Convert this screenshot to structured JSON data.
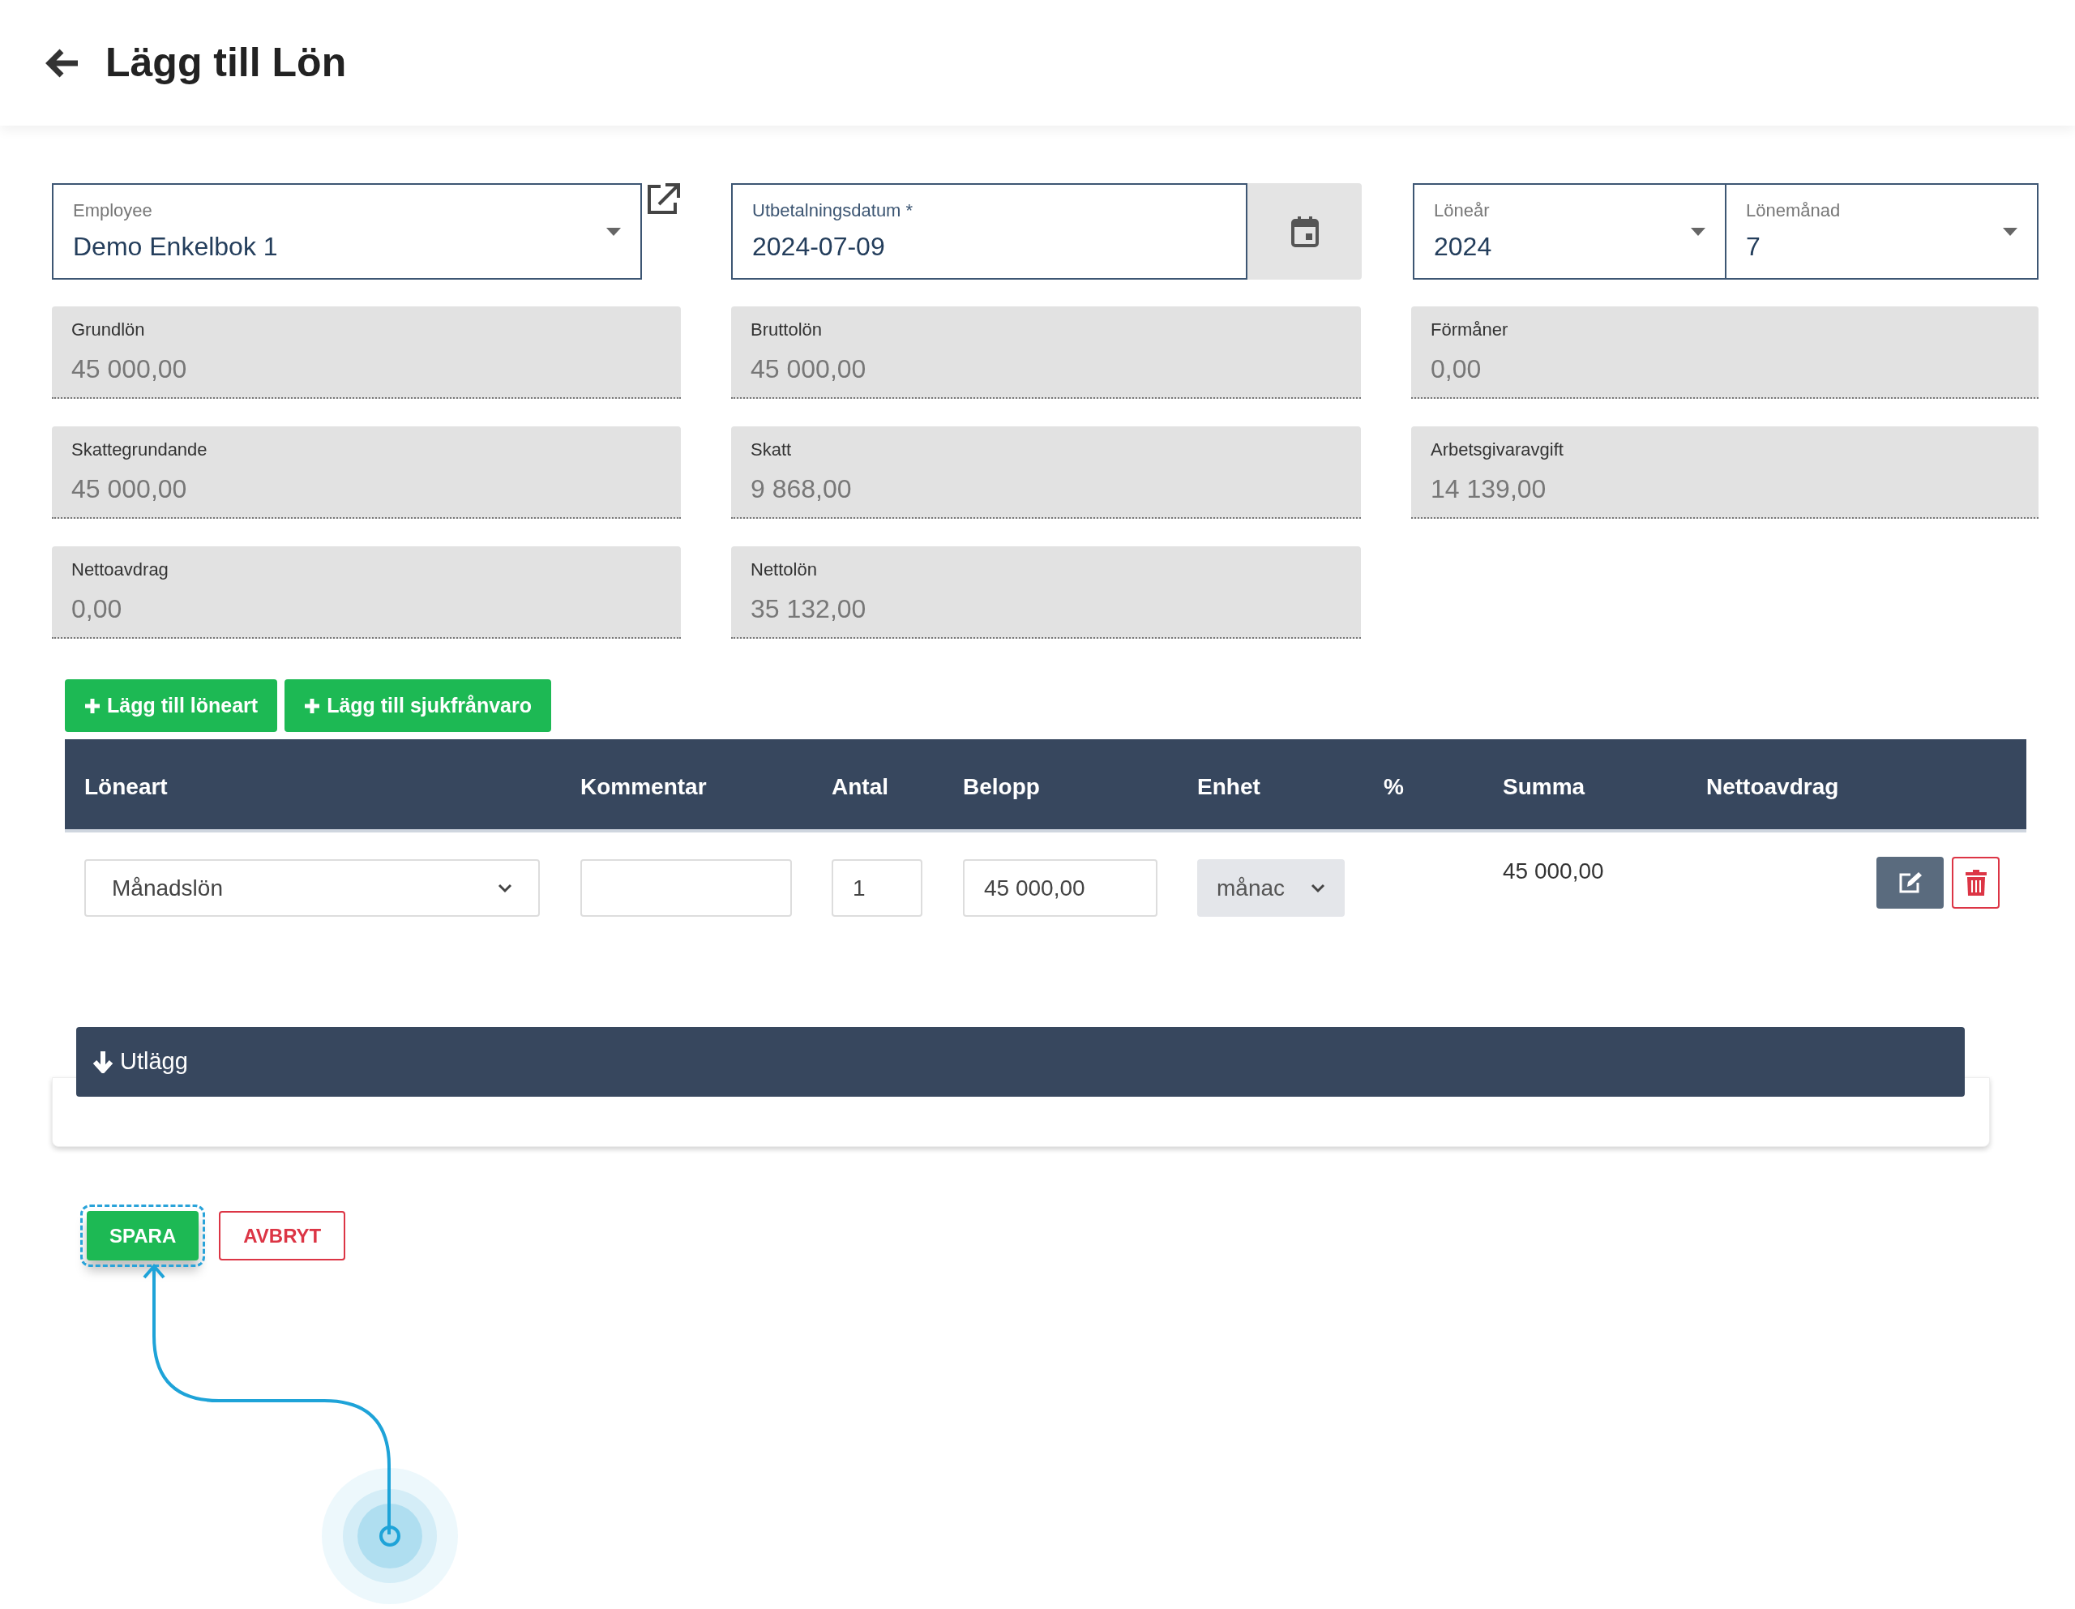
{
  "header": {
    "title": "Lägg till Lön"
  },
  "employee": {
    "label": "Employee",
    "value": "Demo Enkelbok 1"
  },
  "payment_date": {
    "label": "Utbetalningsdatum *",
    "value": "2024-07-09"
  },
  "year": {
    "label": "Löneår",
    "value": "2024"
  },
  "month": {
    "label": "Lönemånad",
    "value": "7"
  },
  "summary_fields": [
    {
      "label": "Grundlön",
      "value": "45 000,00"
    },
    {
      "label": "Bruttolön",
      "value": "45 000,00"
    },
    {
      "label": "Förmåner",
      "value": "0,00"
    },
    {
      "label": "Skattegrundande",
      "value": "45 000,00"
    },
    {
      "label": "Skatt",
      "value": "9 868,00"
    },
    {
      "label": "Arbetsgivaravgift",
      "value": "14 139,00"
    },
    {
      "label": "Nettoavdrag",
      "value": "0,00"
    },
    {
      "label": "Nettolön",
      "value": "35 132,00"
    }
  ],
  "add_buttons": [
    "Lägg till löneart",
    "Lägg till sjukfrånvaro"
  ],
  "table": {
    "columns": [
      "Löneart",
      "Kommentar",
      "Antal",
      "Belopp",
      "Enhet",
      "%",
      "Summa",
      "Nettoavdrag"
    ],
    "rows": [
      {
        "loneart": "Månadslön",
        "antal": "1",
        "belopp": "45 000,00",
        "enhet": "månac",
        "enhet_disabled": true,
        "summa": "45 000,00"
      }
    ]
  },
  "expense_section": {
    "title": "Utlägg"
  },
  "footer_buttons": [
    {
      "label": "SPARA",
      "kind": "primary",
      "focused": true
    },
    {
      "label": "AVBRYT",
      "kind": "cancel",
      "focused": false
    }
  ]
}
